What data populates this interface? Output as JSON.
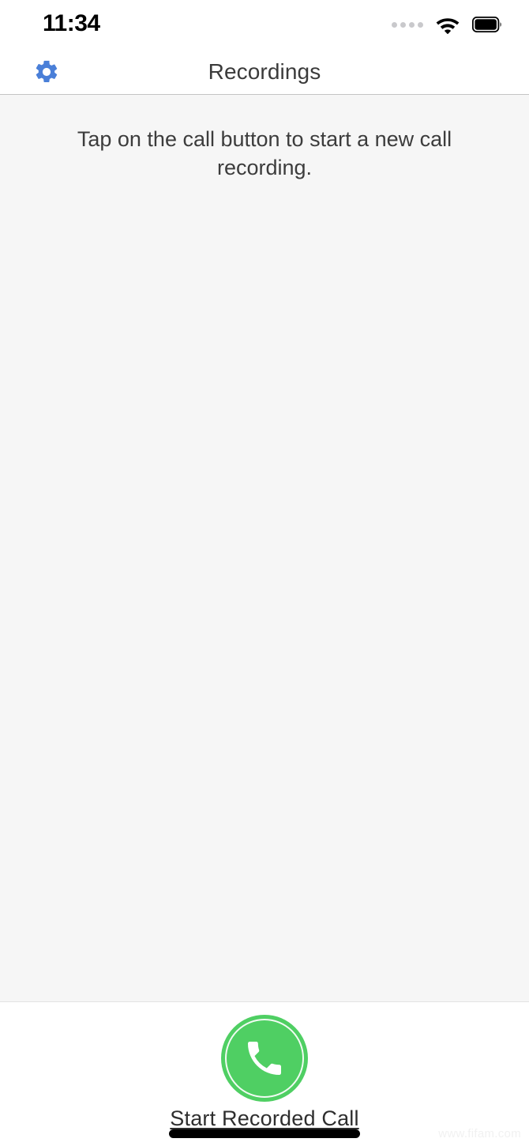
{
  "status_bar": {
    "time": "11:34",
    "signal_dots_count": 4,
    "signal_dots_color": "#c9c9cc",
    "wifi_icon": "wifi-icon",
    "battery_icon": "battery-full-icon",
    "battery_level_percent": 95
  },
  "nav_header": {
    "settings_icon": "gear-icon",
    "settings_icon_color": "#4a7fd8",
    "title": "Recordings",
    "title_color": "#3b3b3b"
  },
  "content": {
    "empty_message": "Tap on the call button to start a new call recording.",
    "background_color": "#f6f6f6"
  },
  "bottom_bar": {
    "call_button": {
      "icon": "phone-handset-icon",
      "color": "#4fcf63",
      "ring_color": "#ffffff"
    },
    "call_label": "Start Recorded Call",
    "home_indicator": "home-indicator",
    "watermark": "www.fifam.com"
  }
}
